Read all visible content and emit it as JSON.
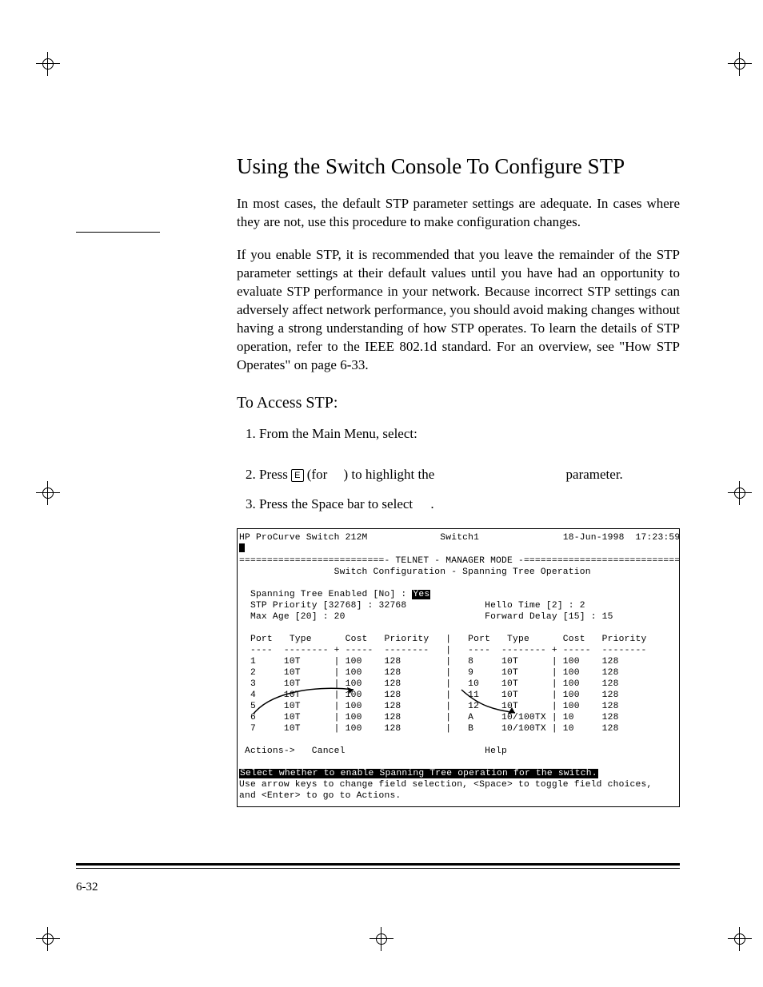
{
  "heading": "Using the Switch Console To Configure STP",
  "para1": "In most cases, the default STP parameter settings are adequate. In cases where they are not, use this procedure to make configuration changes.",
  "para2": "If you enable STP, it is recommended that you leave the remainder of the STP parameter settings at their default values until you have had an opportunity to evaluate STP performance in your network. Because incorrect STP settings can adversely affect network performance, you should avoid making changes without having a strong understanding of how STP operates. To learn the details of STP operation, refer to the IEEE 802.1d standard. For an overview, see \"How STP Operates\" on page 6-33.",
  "subheading": "To Access STP:",
  "steps": {
    "s1": "From the Main Menu, select:",
    "s2a": "Press ",
    "s2key": "E",
    "s2b": " (for ",
    "s2c": ") to highlight the ",
    "s2d": "parameter.",
    "s3a": "Press the Space bar to select ",
    "s3b": "."
  },
  "term": {
    "title_left": "HP ProCurve Switch 212M",
    "title_mid": "Switch1",
    "title_date": "18-Jun-1998  17:23:59",
    "mode": "==========================- TELNET - MANAGER MODE -============================",
    "subtitle": "Switch Configuration - Spanning Tree Operation",
    "cfg": {
      "stp_enabled_label": "Spanning Tree Enabled [No] : ",
      "stp_enabled_value": "Yes",
      "priority": "STP Priority [32768] : 32768",
      "maxage": "Max Age [20] : 20",
      "hello": "Hello Time [2] : 2",
      "fdelay": "Forward Delay [15] : 15"
    },
    "hdr_left": "  Port   Type      Cost   Priority   |   Port   Type      Cost   Priority",
    "hdr_rule": "  ----  -------- + -----  --------   |   ----  -------- + -----  --------",
    "rows": [
      "  1     10T      | 100    128        |   8     10T      | 100    128",
      "  2     10T      | 100    128        |   9     10T      | 100    128",
      "  3     10T      | 100    128        |   10    10T      | 100    128",
      "  4     10T      | 100    128        |   11    10T      | 100    128",
      "  5     10T      | 100    128        |   12    10T      | 100    128",
      "  6     10T      | 100    128        |   A     10/100TX | 10     128",
      "  7     10T      | 100    128        |   B     10/100TX | 10     128"
    ],
    "actions": " Actions->   Cancel                         Help",
    "help1": "Select whether to enable Spanning Tree operation for the switch.",
    "help2": "Use arrow keys to change field selection, <Space> to toggle field choices,",
    "help3": "and <Enter> to go to Actions."
  },
  "pagenum": "6-32"
}
